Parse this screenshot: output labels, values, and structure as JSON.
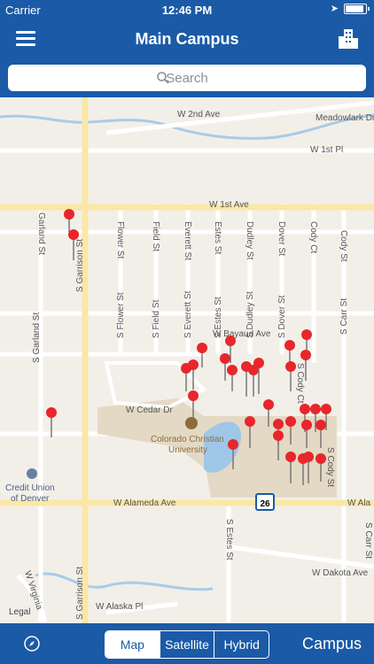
{
  "status": {
    "carrier": "Carrier",
    "time": "12:46 PM"
  },
  "nav": {
    "title": "Main Campus"
  },
  "search": {
    "placeholder": "Search"
  },
  "map": {
    "streets": {
      "w_2nd_ave": "W 2nd Ave",
      "meadowlark_dr": "Meadowlark Dr",
      "w_1st_pl": "W 1st Pl",
      "w_1st_ave": "W 1st Ave",
      "garland_st": "Garland St",
      "s_garrison_st": "S Garrison St",
      "flower_st": "Flower St",
      "field_st": "Field St",
      "everett_st": "Everett St",
      "estes_st": "Estes St",
      "dudley_st": "Dudley St",
      "dover_st": "Dover St",
      "cody_ct": "Cody Ct",
      "cody_st": "Cody St",
      "s_flower_st": "S Flower St",
      "s_field_st": "S Field St",
      "s_everett_st": "S Everett St",
      "s_estes_st": "S Estes St",
      "s_dudley_st": "S Dudley St",
      "s_dover_st": "S Dover St",
      "s_carr_st": "S Carr St",
      "w_bayaud_ave": "W Bayaud Ave",
      "s_cody_ct": "S Cody Ct",
      "s_garland_st": "S Garland St",
      "w_cedar_dr": "W Cedar Dr",
      "s_cody_st": "S Cody St",
      "w_alameda_ave": "W Alameda Ave",
      "w_ala": "W Ala",
      "w_dakota_ave": "W Dakota Ave",
      "w_virginia": "W Virginia",
      "w_alaska_pl": "W Alaska Pl"
    },
    "poi": {
      "university_line1": "Colorado Christian",
      "university_line2": "University",
      "bank_line1": "Credit Union",
      "bank_line2": "of Denver"
    },
    "route_shield": "26",
    "legal": "Legal"
  },
  "toolbar": {
    "map": "Map",
    "satellite": "Satellite",
    "hybrid": "Hybrid",
    "campus": "Campus",
    "selected": "Map"
  }
}
